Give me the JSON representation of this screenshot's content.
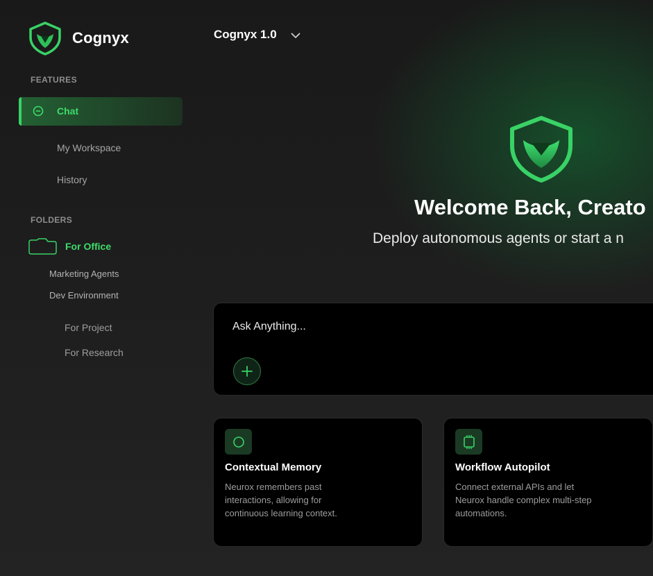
{
  "app": {
    "name": "Cognyx",
    "model": "Cognyx 1.0"
  },
  "sidebar": {
    "features_label": "FEATURES",
    "items": [
      {
        "label": "Chat",
        "active": true
      },
      {
        "label": "My Workspace"
      },
      {
        "label": "History"
      }
    ],
    "folders_label": "FOLDERS",
    "folder": {
      "label": "For Office",
      "children": [
        "Marketing Agents",
        "Dev Environment"
      ]
    },
    "other_folders": [
      "For Project",
      "For Research"
    ]
  },
  "hero": {
    "title": "Welcome Back, Creato",
    "subtitle": "Deploy autonomous agents or start a n"
  },
  "ask": {
    "placeholder": "Ask Anything..."
  },
  "cards": [
    {
      "icon": "circle-icon",
      "title": "Contextual Memory",
      "desc": "Neurox remembers past interactions, allowing for continuous learning context."
    },
    {
      "icon": "chip-icon",
      "title": "Workflow Autopilot",
      "desc": "Connect external APIs and let Neurox handle complex multi-step automations."
    }
  ],
  "colors": {
    "accent": "#39d266",
    "background": "#1f1f1f",
    "card": "#000000"
  }
}
